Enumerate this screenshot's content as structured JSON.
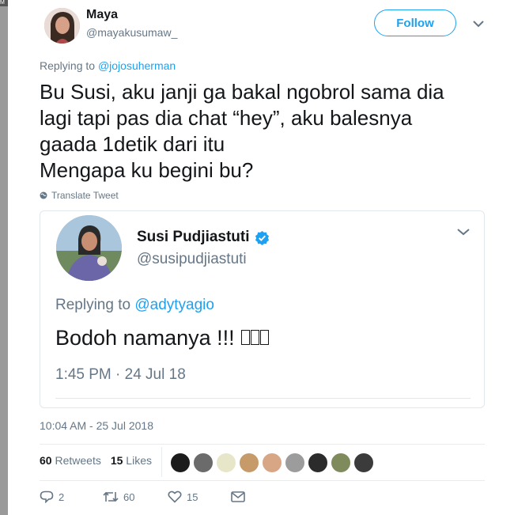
{
  "browser_edge": {
    "label": "M"
  },
  "tweet": {
    "author": {
      "name": "Maya",
      "handle": "@mayakusumaw_"
    },
    "follow_label": "Follow",
    "replying_prefix": "Replying to",
    "replying_to": "@jojosuherman",
    "text": "Bu Susi, aku janji ga bakal ngobrol sama dia\nlagi tapi pas dia chat “hey”, aku balesnya\ngaada 1detik dari itu\nMengapa ku begini bu?",
    "translate_label": "Translate Tweet",
    "timestamp": "10:04 AM - 25 Jul 2018"
  },
  "quoted": {
    "author": {
      "name": "Susi Pudjiastuti",
      "handle": "@susipudjiastuti",
      "verified": true
    },
    "replying_prefix": "Replying to",
    "replying_to": "@adytyagio",
    "text": "Bodoh namanya !!!",
    "time": "1:45 PM · 24 Jul 18"
  },
  "stats": {
    "retweets_count": "60",
    "retweets_label": "Retweets",
    "likes_count": "15",
    "likes_label": "Likes"
  },
  "actions": {
    "reply_count": "2",
    "retweet_count": "60",
    "like_count": "15"
  },
  "colors": {
    "accent": "#1da1f2",
    "text": "#14171a",
    "secondary": "#657786",
    "border": "#e1e8ed",
    "liker_avatars": [
      "#1c1c1c",
      "#6b6b6b",
      "#e8e6c8",
      "#c79a6a",
      "#d8a585",
      "#9c9c9c",
      "#2b2b2b",
      "#7f8a5d",
      "#3b3b3b"
    ]
  },
  "icons": {
    "translate": "globe-icon",
    "caret": "chevron-down-icon",
    "verified": "verified-badge-icon",
    "reply": "reply-icon",
    "retweet": "retweet-icon",
    "like": "heart-icon",
    "dm": "envelope-icon"
  }
}
